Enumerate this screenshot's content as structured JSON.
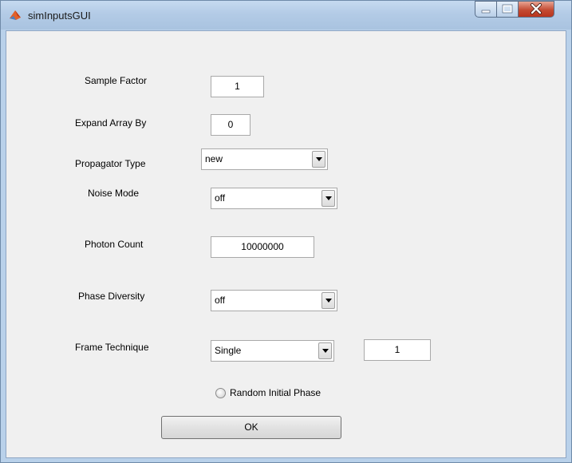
{
  "window": {
    "title": "simInputsGUI"
  },
  "labels": {
    "sample_factor": "Sample Factor",
    "expand_array_by": "Expand Array By",
    "propagator_type": "Propagator Type",
    "noise_mode": "Noise Mode",
    "photon_count": "Photon Count",
    "phase_diversity": "Phase Diversity",
    "frame_technique": "Frame Technique"
  },
  "fields": {
    "sample_factor": "1",
    "expand_array_by": "0",
    "photon_count": "10000000",
    "frame_count": "1"
  },
  "dropdowns": {
    "propagator_type": "new",
    "noise_mode": "off",
    "phase_diversity": "off",
    "frame_technique": "Single"
  },
  "random_initial_phase": {
    "label": "Random Initial Phase",
    "checked": false
  },
  "ok_button": {
    "label": "OK"
  },
  "icons": {
    "app": "matlab-icon",
    "minimize": "minimize-icon",
    "maximize": "maximize-icon",
    "close": "close-icon",
    "dropdown": "chevron-down-icon"
  },
  "colors": {
    "close_button": "#c44b33",
    "titlebar": "#b9d1ea",
    "client": "#f0f0f0"
  }
}
